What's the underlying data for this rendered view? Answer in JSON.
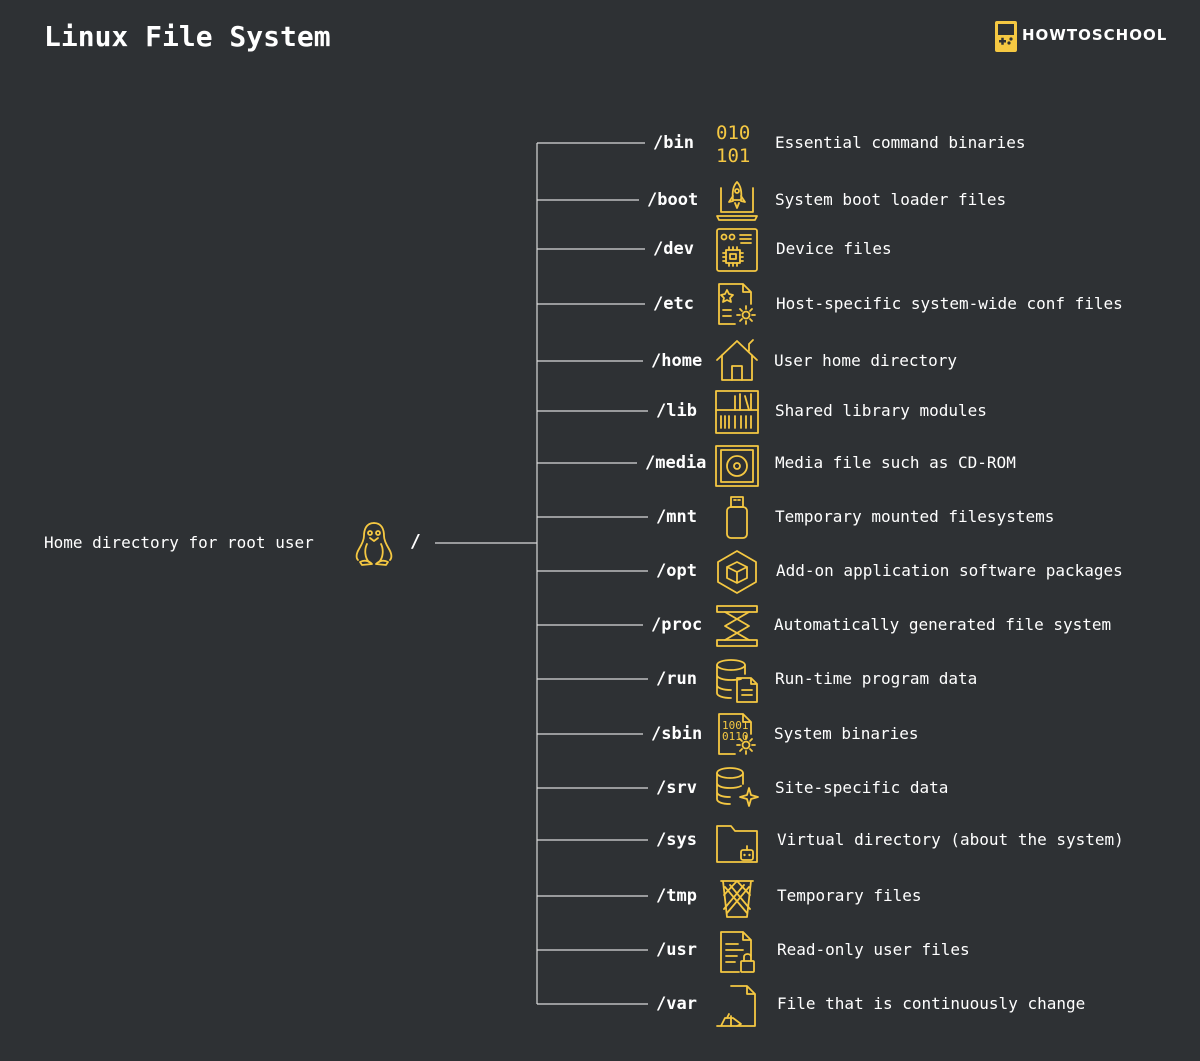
{
  "title": "Linux File System",
  "brand": {
    "name": "HOWTOSCHOOL"
  },
  "root": {
    "label": "Home directory for root user",
    "path": "/"
  },
  "accent_color": "#f5c842",
  "background_color": "#2e3134",
  "directories": [
    {
      "path": "/bin",
      "icon": "binary-digits-icon",
      "description": "Essential command binaries"
    },
    {
      "path": "/boot",
      "icon": "rocket-laptop-icon",
      "description": "System boot loader files"
    },
    {
      "path": "/dev",
      "icon": "device-chip-icon",
      "description": "Device files"
    },
    {
      "path": "/etc",
      "icon": "config-document-icon",
      "description": "Host-specific system-wide conf files"
    },
    {
      "path": "/home",
      "icon": "house-icon",
      "description": "User home directory"
    },
    {
      "path": "/lib",
      "icon": "library-shelf-icon",
      "description": "Shared library modules"
    },
    {
      "path": "/media",
      "icon": "cd-rom-icon",
      "description": "Media file such as CD-ROM"
    },
    {
      "path": "/mnt",
      "icon": "usb-drive-icon",
      "description": "Temporary mounted filesystems"
    },
    {
      "path": "/opt",
      "icon": "package-hexagon-icon",
      "description": "Add-on application software packages"
    },
    {
      "path": "/proc",
      "icon": "scissor-lift-icon",
      "description": "Automatically generated file system"
    },
    {
      "path": "/run",
      "icon": "database-file-icon",
      "description": "Run-time program data"
    },
    {
      "path": "/sbin",
      "icon": "binary-gear-icon",
      "description": "System binaries"
    },
    {
      "path": "/srv",
      "icon": "database-sparkle-icon",
      "description": "Site-specific data"
    },
    {
      "path": "/sys",
      "icon": "folder-robot-icon",
      "description": "Virtual directory (about the system)"
    },
    {
      "path": "/tmp",
      "icon": "trash-basket-icon",
      "description": "Temporary files"
    },
    {
      "path": "/usr",
      "icon": "locked-document-icon",
      "description": "Read-only user files"
    },
    {
      "path": "/var",
      "icon": "changing-file-icon",
      "description": "File that is continuously change"
    }
  ]
}
